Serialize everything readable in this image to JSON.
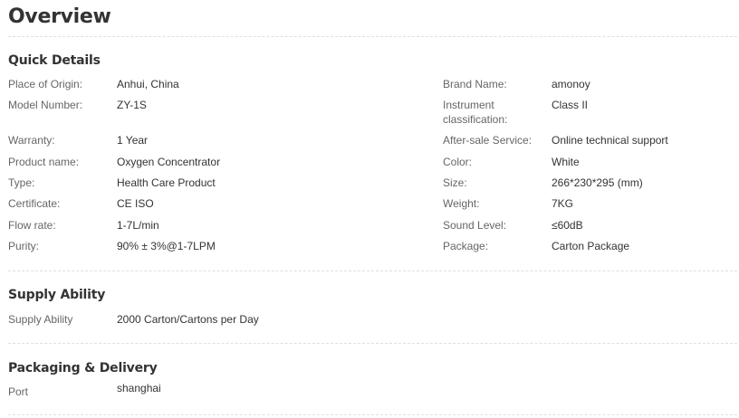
{
  "page_title": "Overview",
  "quick_details": {
    "title": "Quick Details",
    "left": [
      {
        "label": "Place of Origin:",
        "value": "Anhui, China"
      },
      {
        "label": "Model Number:",
        "value": "ZY-1S"
      },
      {
        "label": "Warranty:",
        "value": "1 Year"
      },
      {
        "label": "Product name:",
        "value": "Oxygen Concentrator"
      },
      {
        "label": "Type:",
        "value": "Health Care Product"
      },
      {
        "label": "Certificate:",
        "value": "CE ISO"
      },
      {
        "label": "Flow rate:",
        "value": "1-7L/min"
      },
      {
        "label": "Purity:",
        "value": "90% ± 3%@1-7LPM"
      }
    ],
    "right": [
      {
        "label": "Brand Name:",
        "value": "amonoy"
      },
      {
        "label": "Instrument classification:",
        "value": "Class II"
      },
      {
        "label": "After-sale Service:",
        "value": "Online technical support"
      },
      {
        "label": "Color:",
        "value": "White"
      },
      {
        "label": "Size:",
        "value": "266*230*295 (mm)"
      },
      {
        "label": "Weight:",
        "value": "7KG"
      },
      {
        "label": "Sound Level:",
        "value": "≤60dB"
      },
      {
        "label": "Package:",
        "value": "Carton Package"
      }
    ]
  },
  "supply_ability": {
    "title": "Supply Ability",
    "label": "Supply Ability",
    "value": "2000 Carton/Cartons per Day"
  },
  "packaging_delivery": {
    "title": "Packaging & Delivery",
    "label": "Port",
    "value": "shanghai"
  }
}
